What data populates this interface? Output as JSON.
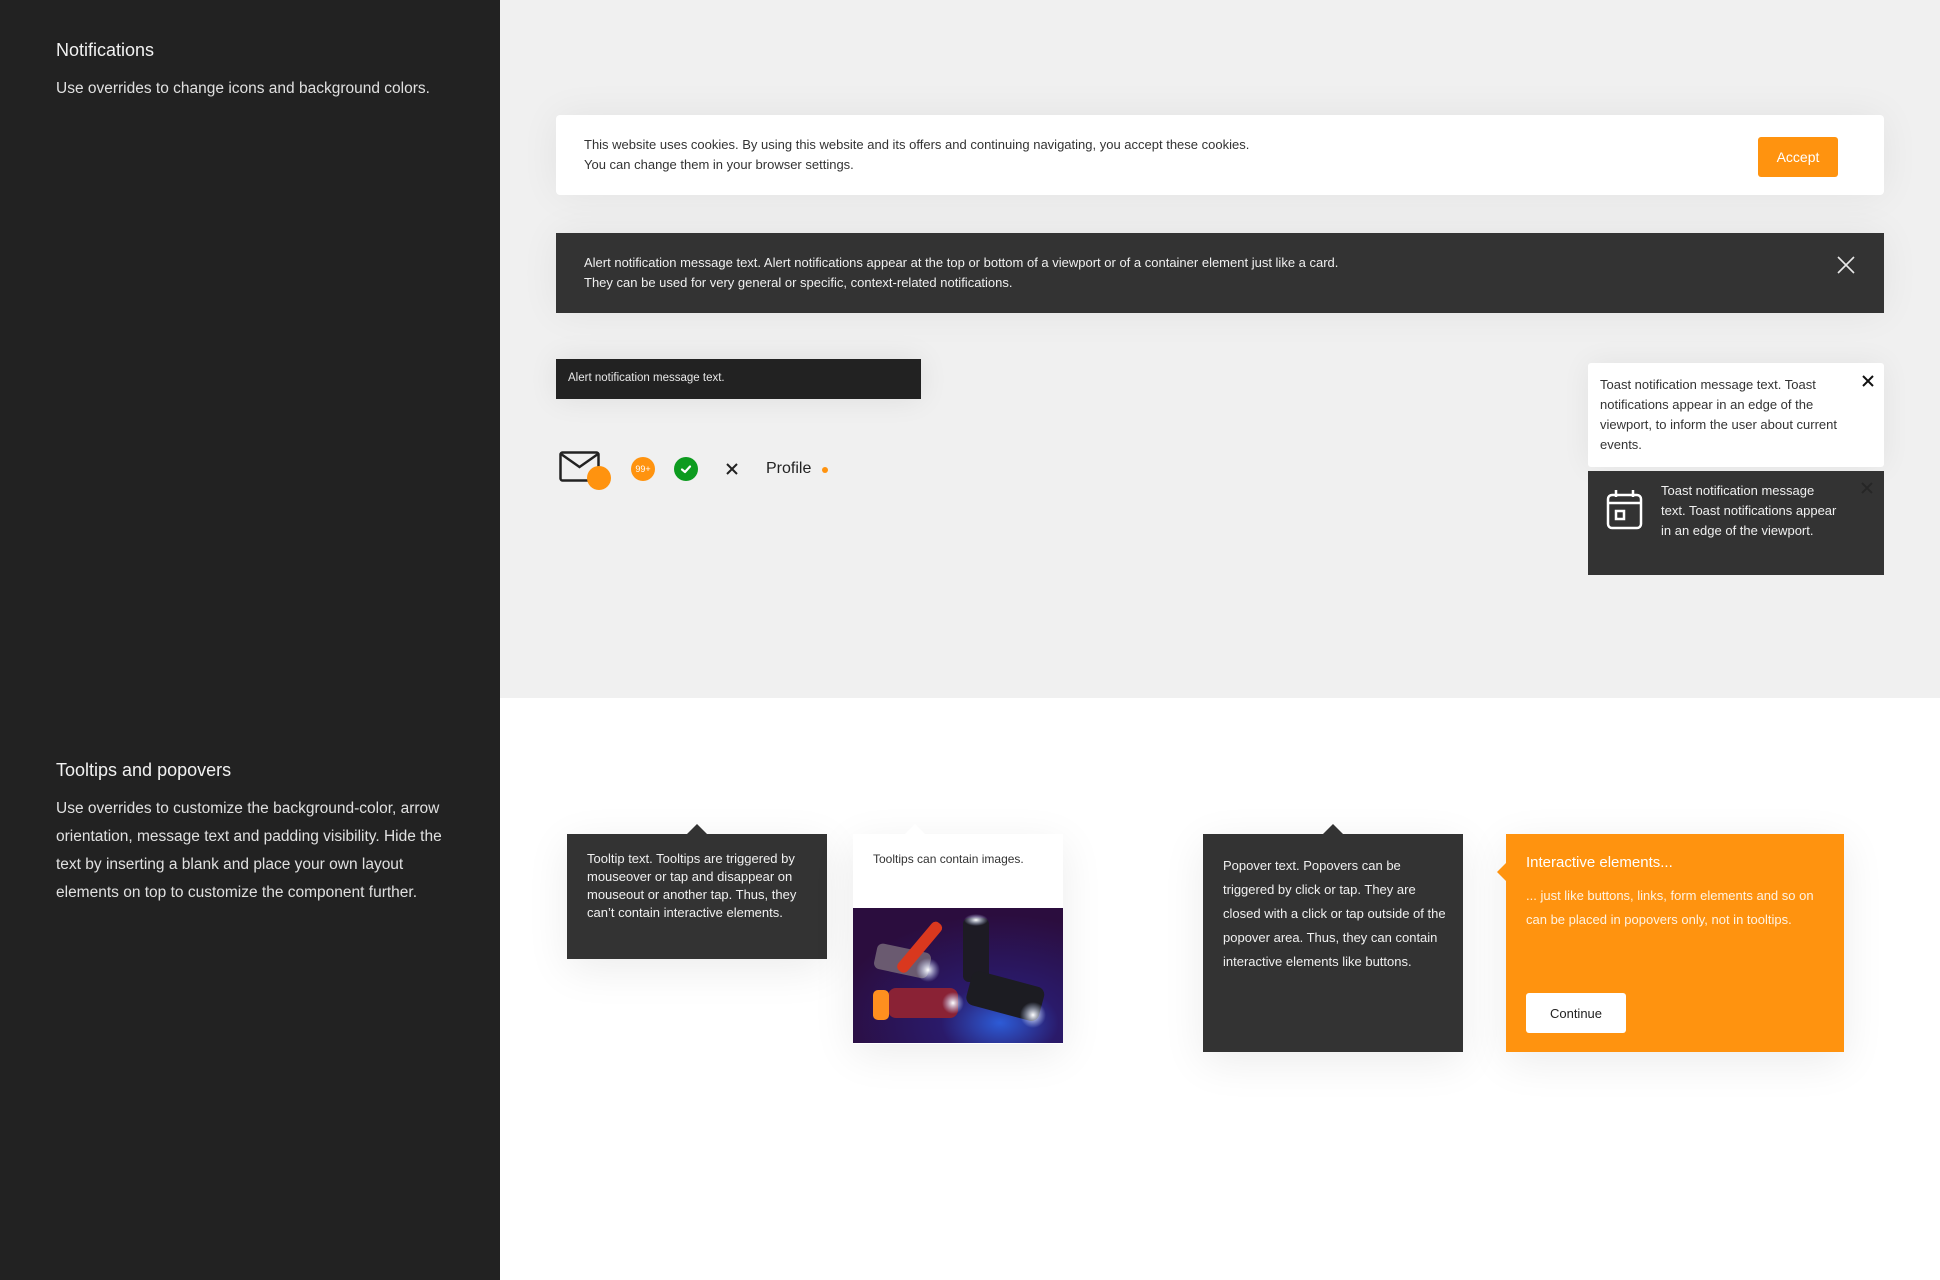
{
  "sidebar": {
    "notifications": {
      "title": "Notifications",
      "description": "Use overrides to change icons and background colors."
    },
    "tooltips": {
      "title": "Tooltips and popovers",
      "description": "Use overrides to customize the background-color, arrow orientation, message text and padding visibility. Hide the text by inserting a blank and place your own layout elements on top to customize the component further."
    }
  },
  "cookie_banner": {
    "line1": "This website uses cookies. By using this website and its offers and continuing navigating, you accept these cookies.",
    "line2": "You can change them in your browser settings.",
    "accept_label": "Accept"
  },
  "alert_banner": {
    "line1": "Alert notification message text. Alert notifications appear at the top or bottom of a viewport or of a container element just like a card.",
    "line2": "They can be used for very general or specific, context-related notifications.",
    "close_icon": "close-icon"
  },
  "alert_small": {
    "text": "Alert notification message text."
  },
  "icon_row": {
    "mail_icon": "mail-icon",
    "count_badge": "99+",
    "check_icon": "check-icon",
    "close_icon": "close-icon",
    "profile_label": "Profile"
  },
  "toasts": {
    "light": {
      "text": "Toast notification message text. Toast notifications appear in an edge of the viewport, to inform the user about current events."
    },
    "dark": {
      "icon": "calendar-icon",
      "text": "Toast notification message text. Toast notifications appear in an edge of the viewport."
    }
  },
  "tooltips": {
    "dark": {
      "text": "Tooltip text. Tooltips are triggered by mouseover or tap and disappear on mouseout or another tap. Thus, they can’t contain interactive elements."
    },
    "image": {
      "text": "Tooltips can contain images."
    }
  },
  "popovers": {
    "dark": {
      "text": "Popover text. Popovers can be triggered by click or tap. They are closed with a click or tap outside of the popover area. Thus, they can contain interactive elements like buttons."
    },
    "orange": {
      "title": "Interactive elements...",
      "text": "... just like buttons, links, form elements and so on can be placed in popovers only, not in tooltips.",
      "button_label": "Continue"
    }
  },
  "colors": {
    "accent": "#ff930f",
    "dark": "#333333",
    "sidebar": "#222222",
    "success": "#0d9b1f",
    "gray_bg": "#f0f0f0"
  }
}
